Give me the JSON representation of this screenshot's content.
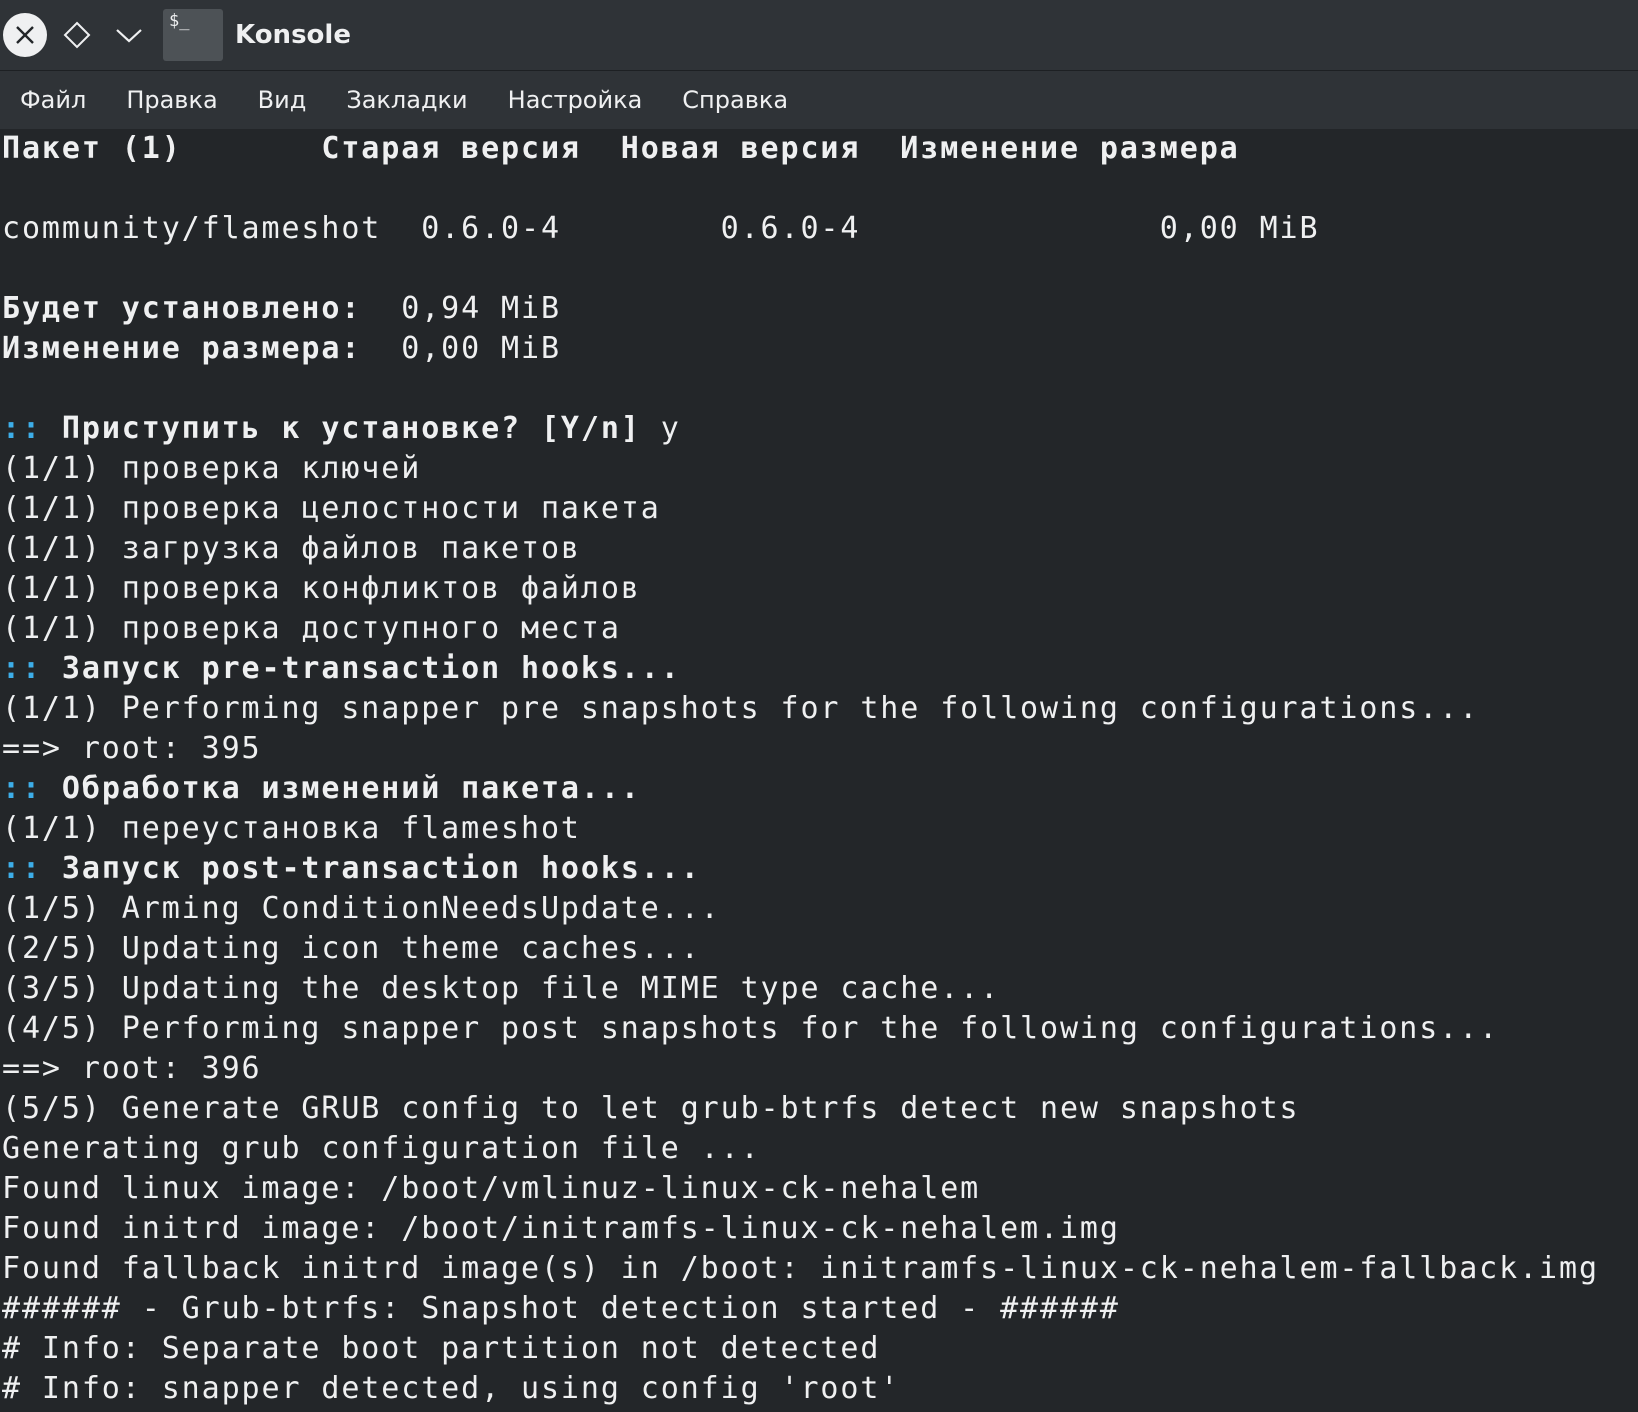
{
  "window": {
    "title": "Konsole",
    "app_icon_glyph": "$_"
  },
  "menu": [
    "Файл",
    "Правка",
    "Вид",
    "Закладки",
    "Настройка",
    "Справка"
  ],
  "colors": {
    "background": "#232629",
    "text": "#eff0f1",
    "accent": "#3daee9",
    "titlebar": "#2f3337"
  },
  "terminal": {
    "lines": [
      {
        "segments": [
          {
            "text": "Пакет (1)       Старая версия  Новая версия  Изменение размера",
            "style": "b"
          }
        ]
      },
      {
        "segments": [
          {
            "text": ""
          }
        ]
      },
      {
        "segments": [
          {
            "text": "community/flameshot  0.6.0-4        0.6.0-4               0,00 MiB"
          }
        ]
      },
      {
        "segments": [
          {
            "text": ""
          }
        ]
      },
      {
        "segments": [
          {
            "text": "Будет установлено:",
            "style": "b"
          },
          {
            "text": "  0,94 MiB"
          }
        ]
      },
      {
        "segments": [
          {
            "text": "Изменение размера:",
            "style": "b"
          },
          {
            "text": "  0,00 MiB"
          }
        ]
      },
      {
        "segments": [
          {
            "text": ""
          }
        ]
      },
      {
        "segments": [
          {
            "text": "::",
            "style": "c"
          },
          {
            "text": " Приступить к установке? [Y/n]",
            "style": "b"
          },
          {
            "text": " y"
          }
        ]
      },
      {
        "segments": [
          {
            "text": "(1/1) проверка ключей"
          }
        ]
      },
      {
        "segments": [
          {
            "text": "(1/1) проверка целостности пакета"
          }
        ]
      },
      {
        "segments": [
          {
            "text": "(1/1) загрузка файлов пакетов"
          }
        ]
      },
      {
        "segments": [
          {
            "text": "(1/1) проверка конфликтов файлов"
          }
        ]
      },
      {
        "segments": [
          {
            "text": "(1/1) проверка доступного места"
          }
        ]
      },
      {
        "segments": [
          {
            "text": "::",
            "style": "c"
          },
          {
            "text": " Запуск pre-transaction hooks...",
            "style": "b"
          }
        ]
      },
      {
        "segments": [
          {
            "text": "(1/1) Performing snapper pre snapshots for the following configurations..."
          }
        ]
      },
      {
        "segments": [
          {
            "text": "==> root: 395"
          }
        ]
      },
      {
        "segments": [
          {
            "text": "::",
            "style": "c"
          },
          {
            "text": " Обработка изменений пакета...",
            "style": "b"
          }
        ]
      },
      {
        "segments": [
          {
            "text": "(1/1) переустановка flameshot"
          }
        ]
      },
      {
        "segments": [
          {
            "text": "::",
            "style": "c"
          },
          {
            "text": " Запуск post-transaction hooks...",
            "style": "b"
          }
        ]
      },
      {
        "segments": [
          {
            "text": "(1/5) Arming ConditionNeedsUpdate..."
          }
        ]
      },
      {
        "segments": [
          {
            "text": "(2/5) Updating icon theme caches..."
          }
        ]
      },
      {
        "segments": [
          {
            "text": "(3/5) Updating the desktop file MIME type cache..."
          }
        ]
      },
      {
        "segments": [
          {
            "text": "(4/5) Performing snapper post snapshots for the following configurations..."
          }
        ]
      },
      {
        "segments": [
          {
            "text": "==> root: 396"
          }
        ]
      },
      {
        "segments": [
          {
            "text": "(5/5) Generate GRUB config to let grub-btrfs detect new snapshots"
          }
        ]
      },
      {
        "segments": [
          {
            "text": "Generating grub configuration file ..."
          }
        ]
      },
      {
        "segments": [
          {
            "text": "Found linux image: /boot/vmlinuz-linux-ck-nehalem"
          }
        ]
      },
      {
        "segments": [
          {
            "text": "Found initrd image: /boot/initramfs-linux-ck-nehalem.img"
          }
        ]
      },
      {
        "segments": [
          {
            "text": "Found fallback initrd image(s) in /boot: initramfs-linux-ck-nehalem-fallback.img"
          }
        ]
      },
      {
        "segments": [
          {
            "text": "###### - Grub-btrfs: Snapshot detection started - ######"
          }
        ]
      },
      {
        "segments": [
          {
            "text": "# Info: Separate boot partition not detected"
          }
        ]
      },
      {
        "segments": [
          {
            "text": "# Info: snapper detected, using config 'root'"
          }
        ]
      }
    ]
  }
}
